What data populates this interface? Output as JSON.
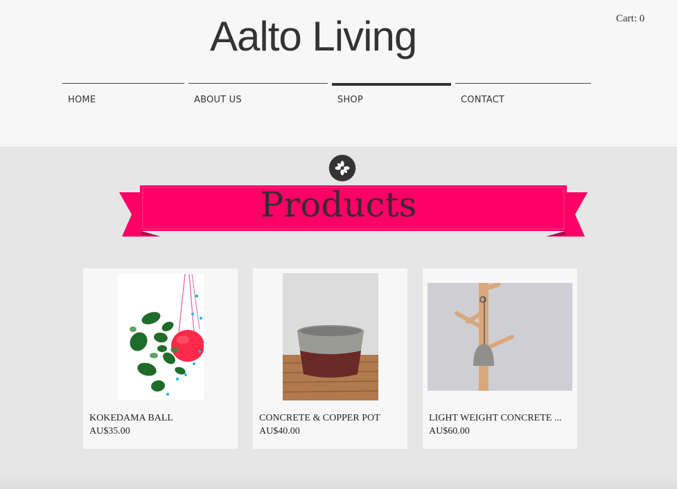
{
  "header": {
    "site_title": "Aalto Living",
    "cart_label": "Cart: 0"
  },
  "nav": {
    "items": [
      {
        "label": "HOME"
      },
      {
        "label": "ABOUT US"
      },
      {
        "label": "SHOP",
        "active": true
      },
      {
        "label": "CONTACT"
      }
    ]
  },
  "section": {
    "title": "Products",
    "badge_icon": "flower-icon",
    "ribbon_color": "#ff0066"
  },
  "products": [
    {
      "name": "KOKEDAMA BALL",
      "price": "AU$35.00",
      "image_icon": "hanging-plant-image"
    },
    {
      "name": "CONCRETE & COPPER POT",
      "price": "AU$40.00",
      "image_icon": "concrete-pot-image"
    },
    {
      "name": "LIGHT WEIGHT CONCRETE ...",
      "price": "AU$60.00",
      "image_icon": "wall-hook-image"
    }
  ]
}
